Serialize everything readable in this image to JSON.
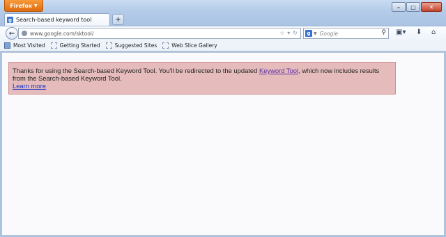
{
  "browser": {
    "menu_button": "Firefox",
    "tab_title": "Search-based keyword tool",
    "new_tab": "+",
    "url": "www.google.com/sktool/",
    "search_placeholder": "Google",
    "window_controls": [
      "minimize-icon",
      "maximize-icon",
      "close-icon"
    ]
  },
  "bookmarks": [
    {
      "label": "Most Visited",
      "icon": "most-visited-icon"
    },
    {
      "label": "Getting Started",
      "icon": "bookmark-icon"
    },
    {
      "label": "Suggested Sites",
      "icon": "bookmark-icon"
    },
    {
      "label": "Web Slice Gallery",
      "icon": "bookmark-icon"
    }
  ],
  "notice": {
    "text_before": "Thanks for using the Search-based Keyword Tool. You'll be redirected to the updated ",
    "link_text": "Keyword Tool",
    "text_after": ", which now includes results from the Search-based Keyword Tool.",
    "learn_more": "Learn more",
    "background": "#e5bcbb"
  }
}
